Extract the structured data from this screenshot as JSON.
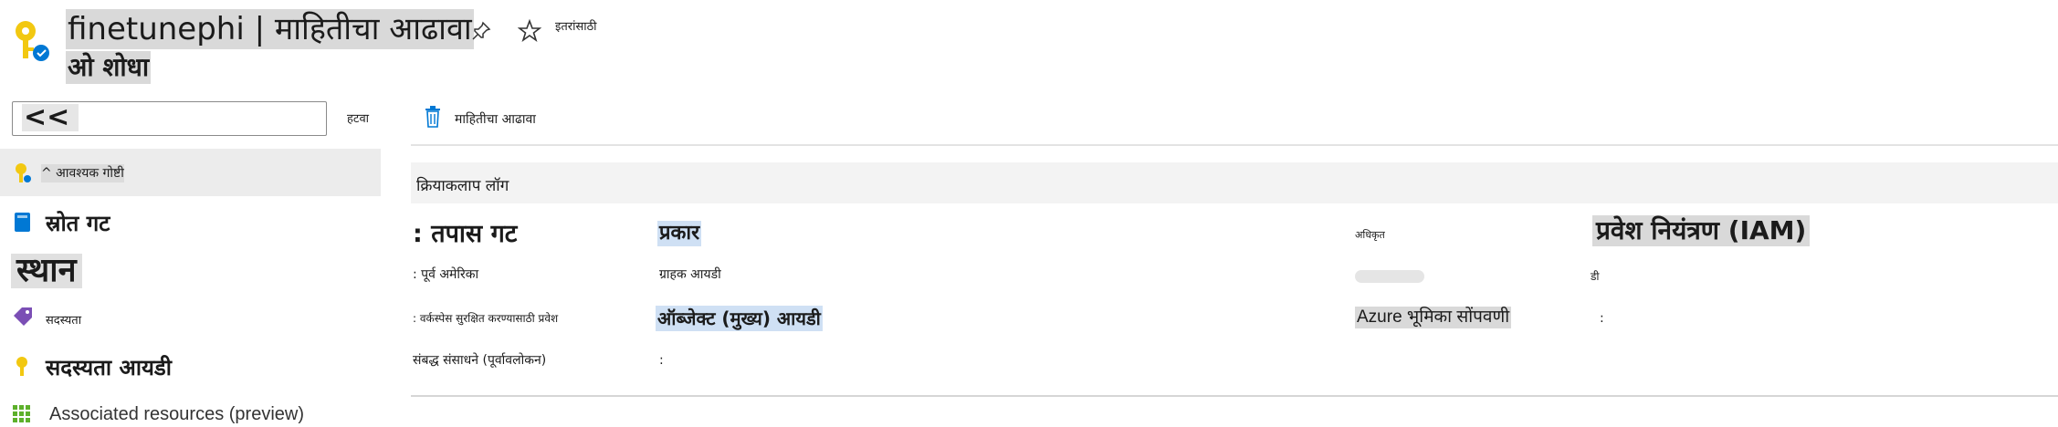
{
  "header": {
    "title": "finetunephi | माहितीचा आढावा",
    "subtitle": "ओ शोधा",
    "favorite_text": "इतरांसाठी"
  },
  "sidebar": {
    "search_value": "<<",
    "collapse_label": "हटवा",
    "items": [
      {
        "label": "^ आवश्यक गोष्टी",
        "icon": "key-icon",
        "active": true
      },
      {
        "label": "स्रोत गट",
        "icon": "resource-group-icon"
      },
      {
        "label": "स्थान"
      },
      {
        "label": "सदस्यता",
        "icon": "tag-icon"
      },
      {
        "label": "सदस्यता आयडी",
        "icon": "key-icon"
      },
      {
        "label": "Associated resources (preview)",
        "icon": "grid-icon"
      }
    ]
  },
  "toolbar": {
    "delete_label": "माहितीचा आढावा"
  },
  "activity_log": {
    "label": "क्रियाकलाप लॉग"
  },
  "essentials": {
    "left": [
      {
        "label": ": तपास गट",
        "value": "प्रकार"
      },
      {
        "label": ": पूर्व अमेरिका",
        "value": "ग्राहक आयडी"
      },
      {
        "label": ": वर्कस्पेस सुरक्षित करण्यासाठी प्रवेश",
        "value": "ऑब्जेक्ट (मुख्य) आयडी"
      },
      {
        "label": "संबद्ध संसाधने (पूर्वावलोकन)",
        "value": ":"
      }
    ],
    "right": [
      {
        "label": "अधिकृत",
        "value": "प्रवेश नियंत्रण (IAM)"
      },
      {
        "label": "",
        "value": "डी"
      },
      {
        "label": "Azure भूमिका सोंपवणी",
        "value": ":"
      }
    ]
  },
  "colors": {
    "accent": "#0078d4",
    "key_icon": "#f2c811",
    "tag_icon": "#7b4fb5",
    "grid_icon": "#5db02b",
    "selection": "#cfe0f4",
    "highlight": "#d9d9d9"
  }
}
